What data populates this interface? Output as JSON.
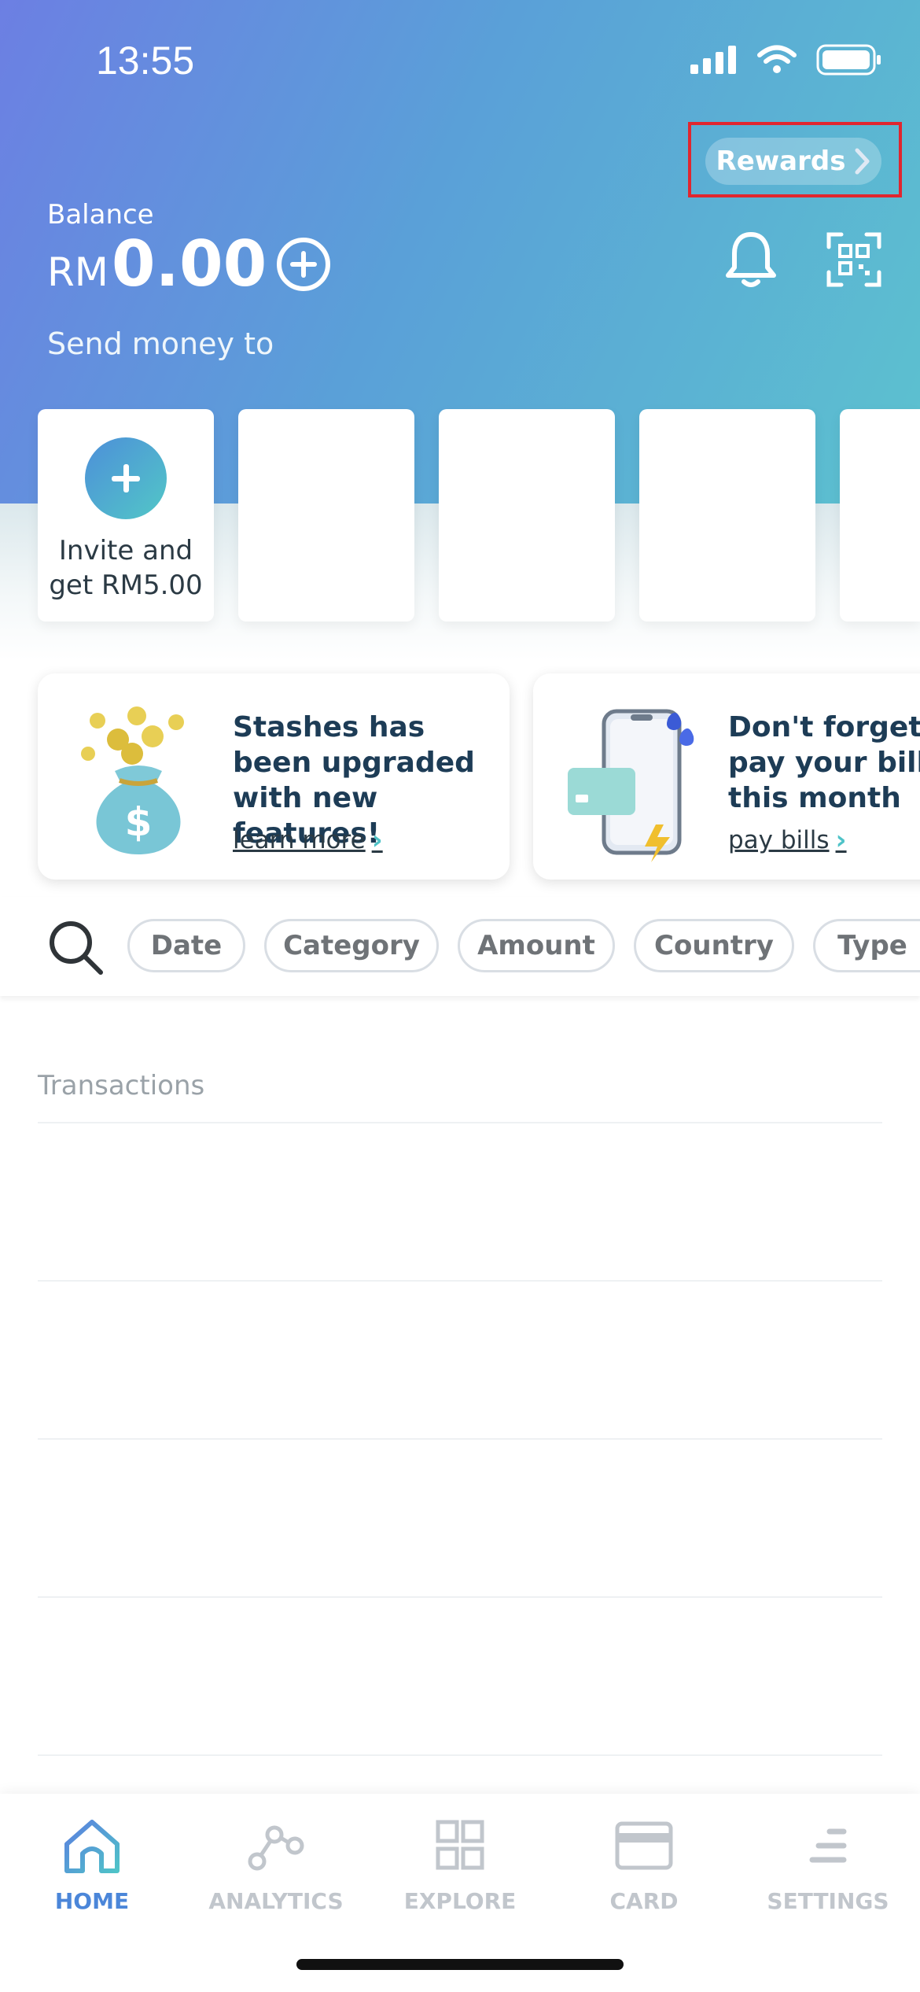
{
  "status_bar": {
    "time": "13:55"
  },
  "header": {
    "rewards_label": "Rewards",
    "balance_label": "Balance",
    "balance_currency": "RM",
    "balance_amount": "0.00",
    "send_money_label": "Send money to"
  },
  "contacts": {
    "invite_line1": "Invite and",
    "invite_line2": "get RM5.00"
  },
  "promos": [
    {
      "title": "Stashes has been upgraded with new features!",
      "link": "learn more"
    },
    {
      "title": "Don't forget to pay your bills this month",
      "link": "pay bills"
    }
  ],
  "filters": [
    "Date",
    "Category",
    "Amount",
    "Country",
    "Type"
  ],
  "transactions": {
    "title": "Transactions"
  },
  "tabs": [
    {
      "label": "HOME",
      "icon": "home-icon"
    },
    {
      "label": "ANALYTICS",
      "icon": "analytics-icon"
    },
    {
      "label": "EXPLORE",
      "icon": "explore-icon"
    },
    {
      "label": "CARD",
      "icon": "card-icon"
    },
    {
      "label": "SETTINGS",
      "icon": "settings-icon"
    }
  ],
  "colors": {
    "accent": "#4b86d9",
    "teal": "#4fc3c8",
    "highlight_frame": "#e0262f"
  }
}
